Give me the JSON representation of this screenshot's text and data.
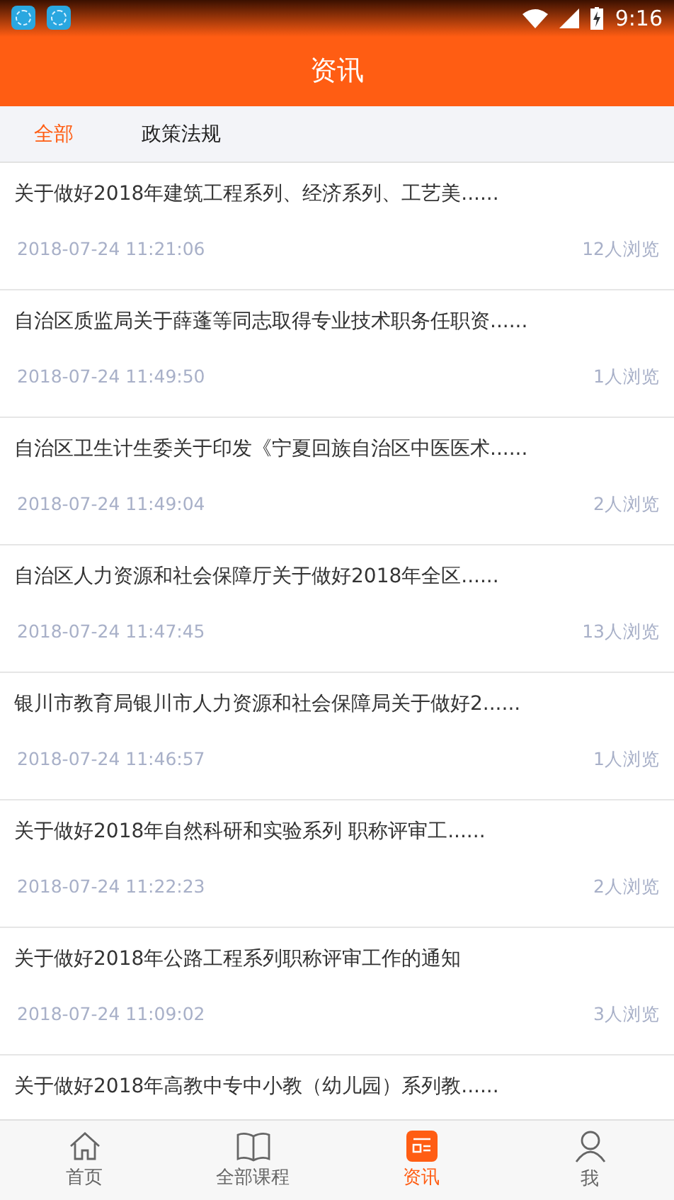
{
  "status_bar": {
    "time": "9:16"
  },
  "header": {
    "title": "资讯"
  },
  "tabs": [
    {
      "label": "全部",
      "selected": true
    },
    {
      "label": "政策法规",
      "selected": false
    }
  ],
  "articles": [
    {
      "title": "关于做好2018年建筑工程系列、经济系列、工艺美......",
      "date": "2018-07-24 11:21:06",
      "views": "12人浏览"
    },
    {
      "title": "自治区质监局关于薛蓬等同志取得专业技术职务任职资......",
      "date": "2018-07-24 11:49:50",
      "views": "1人浏览"
    },
    {
      "title": "自治区卫生计生委关于印发《宁夏回族自治区中医医术......",
      "date": "2018-07-24 11:49:04",
      "views": "2人浏览"
    },
    {
      "title": "自治区人力资源和社会保障厅关于做好2018年全区......",
      "date": "2018-07-24 11:47:45",
      "views": "13人浏览"
    },
    {
      "title": "银川市教育局银川市人力资源和社会保障局关于做好2......",
      "date": "2018-07-24 11:46:57",
      "views": "1人浏览"
    },
    {
      "title": "关于做好2018年自然科研和实验系列 职称评审工......",
      "date": "2018-07-24 11:22:23",
      "views": "2人浏览"
    },
    {
      "title": "关于做好2018年公路工程系列职称评审工作的通知",
      "date": "2018-07-24 11:09:02",
      "views": "3人浏览"
    },
    {
      "title": "关于做好2018年高教中专中小教（幼儿园）系列教......"
    }
  ],
  "bottom_nav": [
    {
      "kind": "home",
      "label": "首页",
      "selected": false
    },
    {
      "kind": "book",
      "label": "全部课程",
      "selected": false
    },
    {
      "kind": "news",
      "label": "资讯",
      "selected": true
    },
    {
      "kind": "person",
      "label": "我",
      "selected": false
    }
  ]
}
